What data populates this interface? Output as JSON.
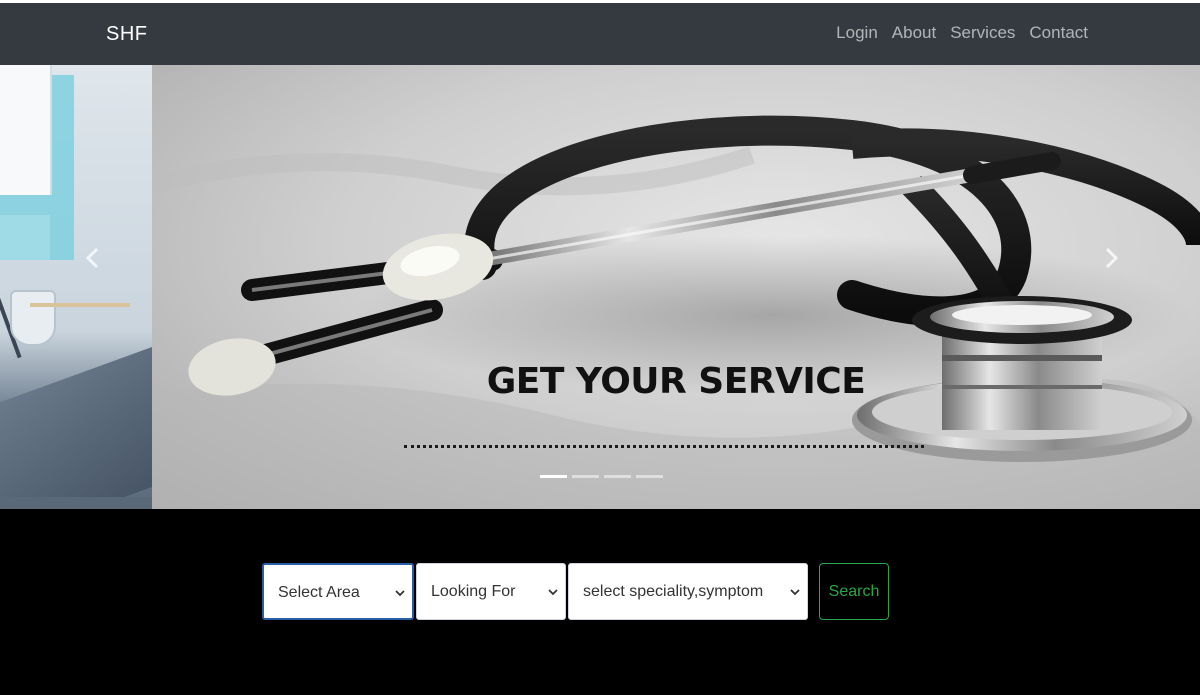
{
  "navbar": {
    "brand": "SHF",
    "links": [
      {
        "label": "Login"
      },
      {
        "label": "About"
      },
      {
        "label": "Services"
      },
      {
        "label": "Contact"
      }
    ]
  },
  "carousel": {
    "caption": "GET YOUR SERVICE",
    "indicator_count": 4,
    "active_index": 0
  },
  "search": {
    "area_value": "Select Area",
    "looking_value": "Looking For",
    "speciality_value": "select speciality,symptom",
    "button_label": "Search"
  },
  "colors": {
    "navbar_bg": "#343a40",
    "search_accent": "#28a745",
    "focus_border": "#2a5fa8"
  }
}
